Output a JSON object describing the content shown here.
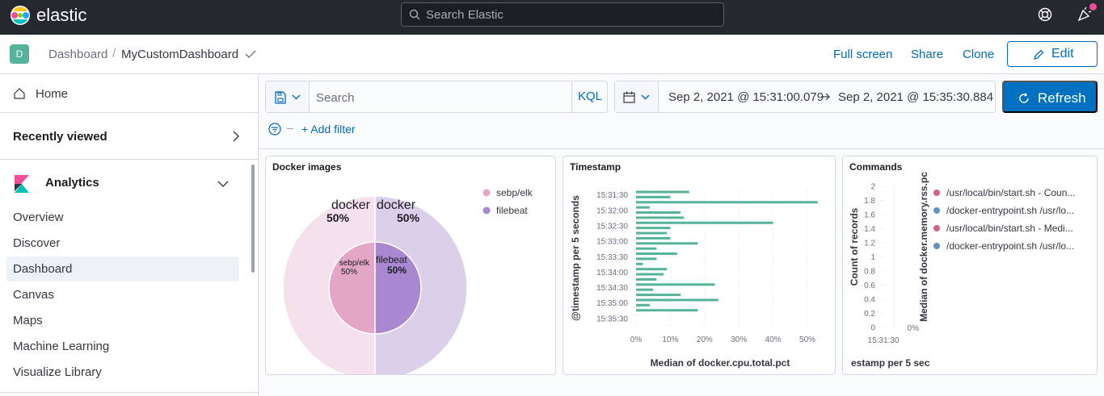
{
  "app": {
    "brand": "elastic",
    "search_placeholder": "Search Elastic"
  },
  "header": {
    "space_initial": "D",
    "breadcrumb_root": "Dashboard",
    "breadcrumb_separator": "/",
    "breadcrumb_current": "MyCustomDashboard",
    "full_screen": "Full screen",
    "share": "Share",
    "clone": "Clone",
    "edit": "Edit"
  },
  "sidebar": {
    "home": "Home",
    "recently_viewed": "Recently viewed",
    "analytics": "Analytics",
    "items": [
      "Overview",
      "Discover",
      "Dashboard",
      "Canvas",
      "Maps",
      "Machine Learning",
      "Visualize Library"
    ],
    "active_item": "Dashboard"
  },
  "query": {
    "search_placeholder": "Search",
    "language": "KQL",
    "date_start": "Sep 2, 2021 @ 15:31:00.079",
    "date_end": "Sep 2, 2021 @ 15:35:30.884",
    "refresh": "Refresh",
    "add_filter": "+ Add filter"
  },
  "colors": {
    "accent": "#006bb8",
    "refresh_bg": "#0070c0",
    "bar": "#54b399",
    "pink": "#d36086",
    "blue": "#6092c0"
  },
  "panels": {
    "docker_images": {
      "title": "Docker images",
      "outer_labels": [
        {
          "name": "docker",
          "pct": "50%"
        },
        {
          "name": "docker",
          "pct": "50%"
        }
      ],
      "inner_labels": [
        {
          "name": "sebp/elk",
          "pct": "50%"
        },
        {
          "name": "filebeat",
          "pct": "50%"
        }
      ],
      "legend": [
        "sebp/elk",
        "filebeat"
      ]
    },
    "timestamp": {
      "title": "Timestamp",
      "y_axis_title": "@timestamp per 5 seconds",
      "x_axis_title": "Median of docker.cpu.total.pct",
      "y_ticks": [
        "15:31:30",
        "15:32:00",
        "15:32:30",
        "15:33:00",
        "15:33:30",
        "15:34:00",
        "15:34:30",
        "15:35:00",
        "15:35:30"
      ],
      "x_ticks": [
        "0%",
        "10%",
        "20%",
        "30%",
        "40%",
        "50%"
      ]
    },
    "commands": {
      "title": "Commands",
      "left_axis_title": "Count of records",
      "right_axis_title": "Median of docker.memory.rss.pc",
      "y_ticks": [
        "2",
        "1.8",
        "1.6",
        "1.4",
        "1.2",
        "1",
        "0.8",
        "0.6",
        "0.4",
        "0.2",
        "0"
      ],
      "right_tick": "0%",
      "x_tick": "15:31:30",
      "x_axis_title": "estamp per 5 sec",
      "legend": [
        {
          "label": "/usr/local/bin/start.sh - Coun...",
          "color": "#d36086"
        },
        {
          "label": "/docker-entrypoint.sh /usr/lo...",
          "color": "#6092c0"
        },
        {
          "label": "/usr/local/bin/start.sh - Medi...",
          "color": "#d36086"
        },
        {
          "label": "/docker-entrypoint.sh /usr/lo...",
          "color": "#6092c0"
        }
      ]
    }
  },
  "chart_data": [
    {
      "type": "pie",
      "title": "Docker images",
      "rings": [
        {
          "labels": [
            "docker",
            "docker"
          ],
          "values": [
            50,
            50
          ]
        },
        {
          "labels": [
            "sebp/elk",
            "filebeat"
          ],
          "values": [
            50,
            50
          ]
        }
      ],
      "legend": [
        "sebp/elk",
        "filebeat"
      ],
      "colors": {
        "sebp/elk": "#e4a6c7",
        "filebeat": "#a987d1",
        "outer_left": "#f5e1ec",
        "outer_right": "#dccfea"
      }
    },
    {
      "type": "bar",
      "orientation": "horizontal",
      "title": "Timestamp",
      "xlabel": "Median of docker.cpu.total.pct",
      "ylabel": "@timestamp per 5 seconds",
      "xlim": [
        0,
        54
      ],
      "values": [
        15.5,
        10,
        53,
        4,
        13,
        14,
        40,
        10,
        9,
        10,
        18,
        6,
        12,
        6,
        2,
        9,
        8,
        6,
        23,
        5,
        13,
        24,
        4,
        18
      ],
      "color": "#54b399",
      "grid": true
    },
    {
      "type": "line",
      "title": "Commands",
      "ylabel": "Count of records",
      "y2label": "Median of docker.memory.rss.pc",
      "ylim": [
        0,
        2
      ],
      "x": [
        "15:31:30"
      ],
      "series": [
        {
          "name": "/usr/local/bin/start.sh - Coun...",
          "values": []
        },
        {
          "name": "/docker-entrypoint.sh /usr/lo...",
          "values": []
        },
        {
          "name": "/usr/local/bin/start.sh - Medi...",
          "values": []
        },
        {
          "name": "/docker-entrypoint.sh /usr/lo...",
          "values": []
        }
      ]
    }
  ]
}
